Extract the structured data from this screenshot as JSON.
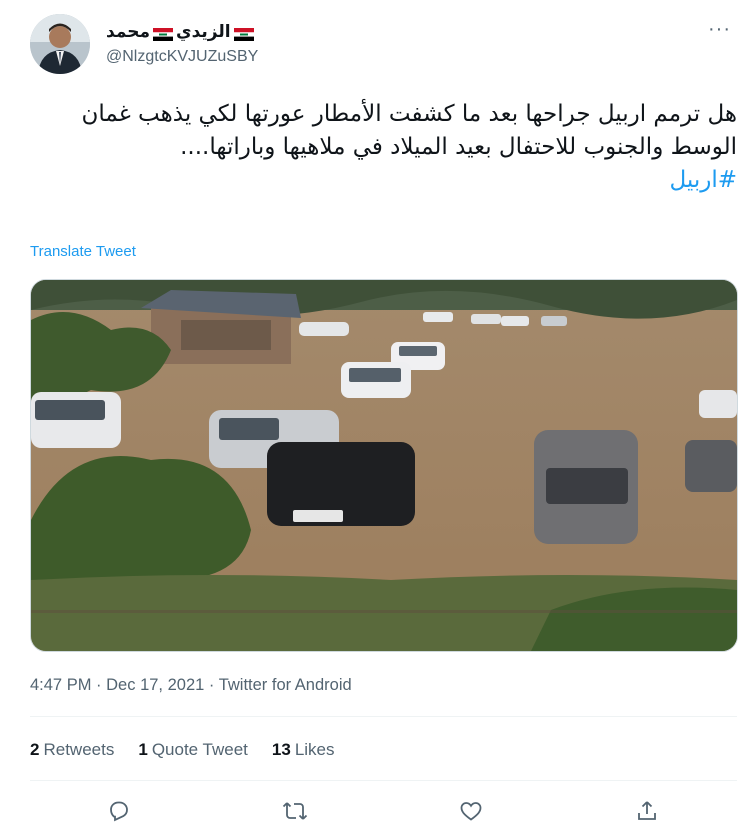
{
  "author": {
    "display_name": "محمد الزيدي",
    "first_name": "محمد",
    "last_name": "الزيدي",
    "handle": "@NlzgtcKVJUZuSBY"
  },
  "menu": {
    "more_label": "···"
  },
  "tweet": {
    "text": "هل ترمم اربيل جراحها بعد ما كشفت الأمطار عورتها لكي يذهب غمان الوسط والجنوب للاحتفال بعيد الميلاد في ملاهيها وباراتها....",
    "hashtag": "#اربيل",
    "translate_label": "Translate Tweet"
  },
  "meta": {
    "time": "4:47 PM",
    "date": "Dec 17, 2021",
    "source": "Twitter for Android",
    "sep": "·"
  },
  "stats": {
    "retweets_count": "2",
    "retweets_label": "Retweets",
    "quotes_count": "1",
    "quotes_label": "Quote Tweet",
    "likes_count": "13",
    "likes_label": "Likes"
  },
  "icons": {
    "reply": "reply-icon",
    "retweet": "retweet-icon",
    "like": "like-icon",
    "share": "share-icon"
  },
  "colors": {
    "link": "#1d9bf0",
    "secondary_text": "#536471",
    "divider": "#eff3f4"
  }
}
